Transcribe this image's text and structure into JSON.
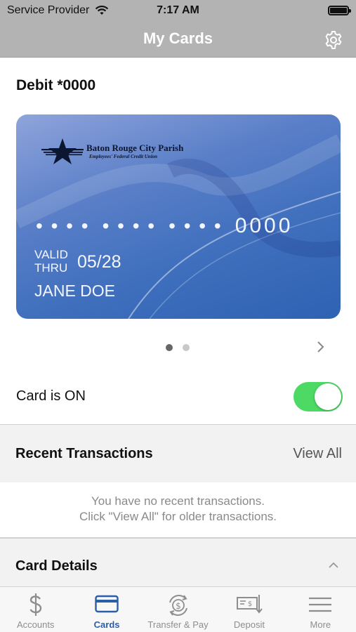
{
  "status_bar": {
    "carrier": "Service Provider",
    "time": "7:17 AM"
  },
  "nav": {
    "title": "My Cards"
  },
  "card": {
    "name": "Debit *0000",
    "bank_name": "Baton Rouge City Parish",
    "bank_subtitle": "Employees' Federal Credit Union",
    "masked_groups": [
      "• • • •",
      "• • • •",
      "• • • •"
    ],
    "last4": "0000",
    "valid_label_1": "VALID",
    "valid_label_2": "THRU",
    "expiry": "05/28",
    "holder": "JANE DOE",
    "colors": {
      "gradient_start": "#8fa4db",
      "gradient_end": "#2e62b3"
    }
  },
  "pager": {
    "count": 2,
    "active_index": 0
  },
  "card_toggle": {
    "label": "Card is ON",
    "on": true,
    "color": "#4cd964"
  },
  "recent_transactions": {
    "title": "Recent Transactions",
    "view_all": "View All",
    "empty_line_1": "You have no recent transactions.",
    "empty_line_2": "Click \"View All\" for older transactions."
  },
  "card_details": {
    "title": "Card Details"
  },
  "tabs": [
    {
      "label": "Accounts",
      "icon": "dollar-icon",
      "active": false
    },
    {
      "label": "Cards",
      "icon": "card-icon",
      "active": true
    },
    {
      "label": "Transfer & Pay",
      "icon": "transfer-icon",
      "active": false
    },
    {
      "label": "Deposit",
      "icon": "deposit-icon",
      "active": false
    },
    {
      "label": "More",
      "icon": "menu-icon",
      "active": false
    }
  ],
  "accent_color": "#2a5ea8"
}
